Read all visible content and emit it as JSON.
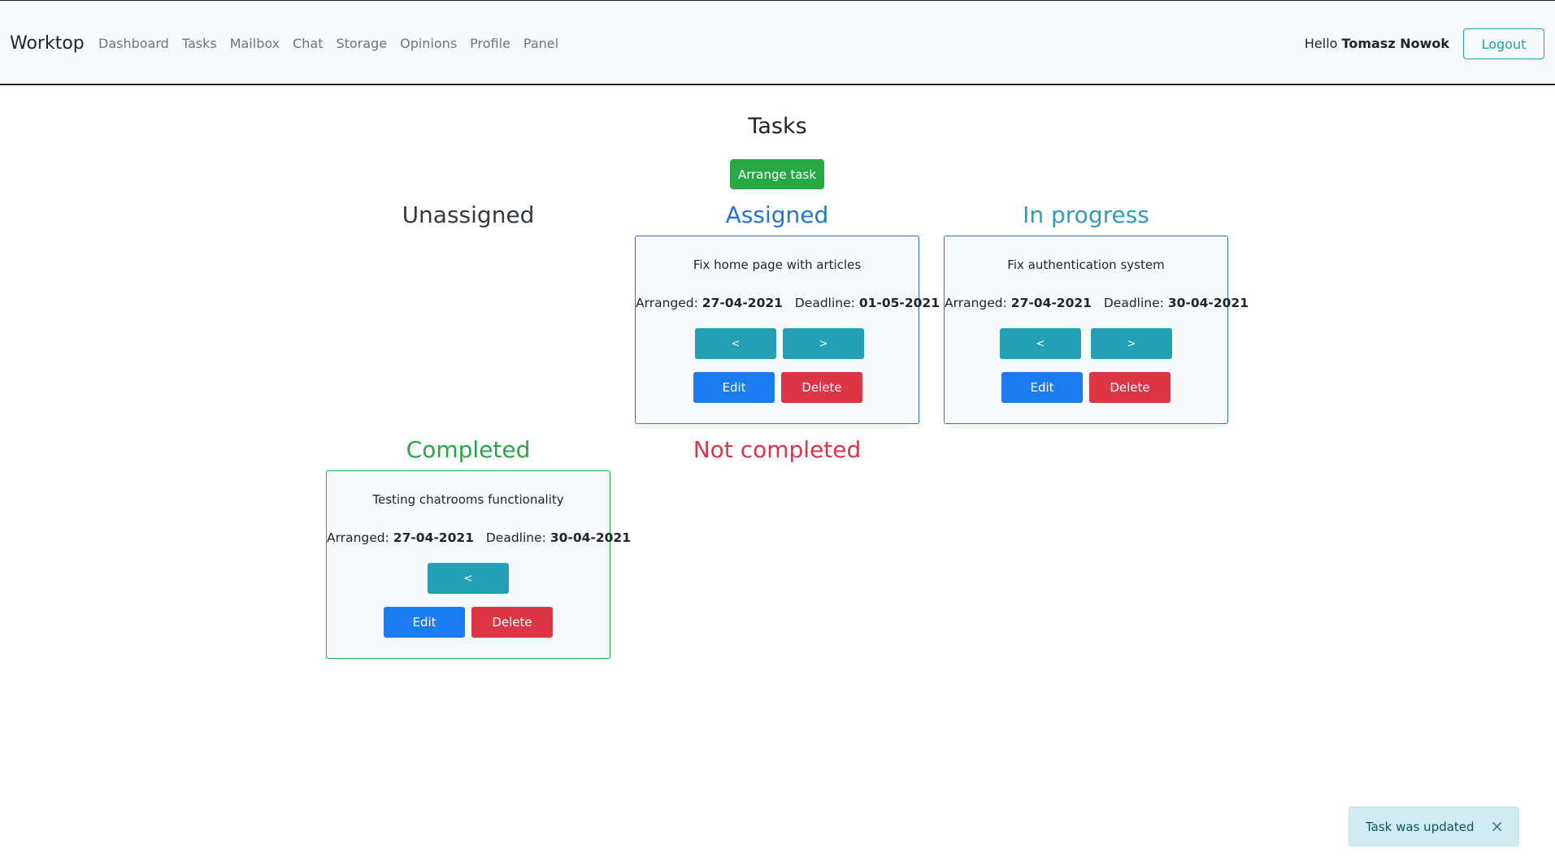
{
  "navbar": {
    "brand": "Worktop",
    "links": [
      "Dashboard",
      "Tasks",
      "Mailbox",
      "Chat",
      "Storage",
      "Opinions",
      "Profile",
      "Panel"
    ],
    "greeting_prefix": "Hello",
    "user_name": "Tomasz Nowok",
    "logout_label": "Logout"
  },
  "page": {
    "title": "Tasks",
    "arrange_label": "Arrange task"
  },
  "columns": {
    "unassigned": "Unassigned",
    "assigned": "Assigned",
    "in_progress": "In progress",
    "completed": "Completed",
    "not_completed": "Not completed"
  },
  "labels": {
    "arranged": "Arranged:",
    "deadline": "Deadline:",
    "prev": "<",
    "next": ">",
    "edit": "Edit",
    "delete": "Delete"
  },
  "tasks": {
    "assigned": {
      "title": "Fix home page with articles",
      "arranged": "27-04-2021",
      "deadline": "01-05-2021"
    },
    "in_progress": {
      "title": "Fix authentication system",
      "arranged": "27-04-2021",
      "deadline": "30-04-2021"
    },
    "completed": {
      "title": "Testing chatrooms functionality",
      "arranged": "27-04-2021",
      "deadline": "30-04-2021"
    }
  },
  "toast": {
    "message": "Task was updated",
    "close_glyph": "×"
  },
  "colors": {
    "success": "#28a745",
    "danger": "#dc3545",
    "primary": "#1b7bf0",
    "info": "#23a0b4"
  }
}
